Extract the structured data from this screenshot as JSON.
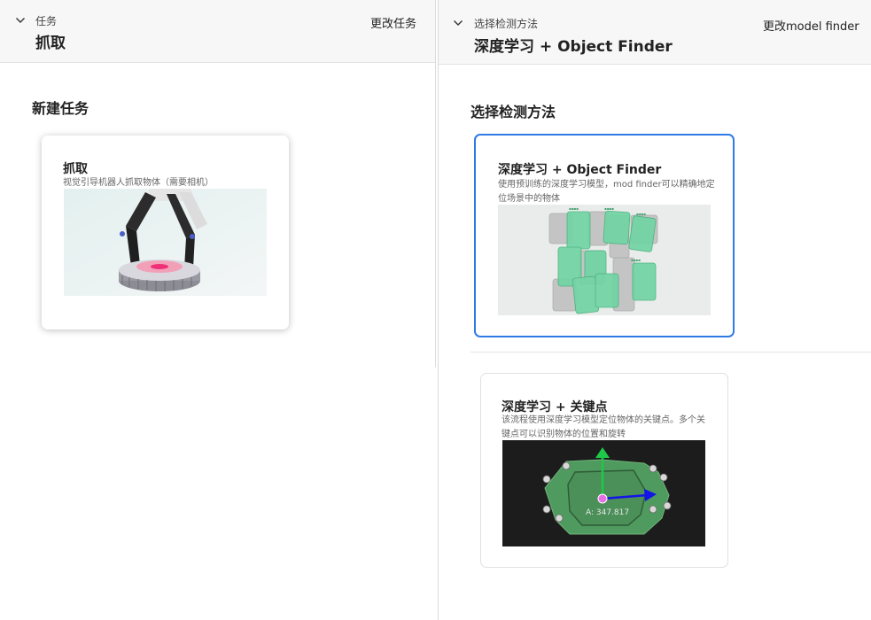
{
  "left": {
    "header": {
      "small_label": "任务",
      "title": "抓取",
      "action": "更改任务"
    },
    "section_title": "新建任务",
    "card": {
      "title": "抓取",
      "description": "视觉引导机器人抓取物体（需要相机）",
      "image_icon": "robot-gripper-picking-gear"
    }
  },
  "right": {
    "header": {
      "small_label": "选择检测方法",
      "title": "深度学习 + Object Finder",
      "action": "更改model finder"
    },
    "section_title": "选择检测方法",
    "cards": [
      {
        "title": "深度学习 + Object Finder",
        "description": "使用预训练的深度学习模型，mod finder可以精确地定位场景中的物体",
        "selected": true,
        "image_icon": "detected-boxes-scene"
      },
      {
        "title": "深度学习 + 关键点",
        "description": "该流程使用深度学习模型定位物体的关键点。多个关键点可以识别物体的位置和旋转",
        "selected": false,
        "image_icon": "keypoint-part-axes",
        "image_label": "A: 347.817"
      }
    ]
  },
  "colors": {
    "accent": "#2f7be5",
    "header_bg": "#f7f7f7",
    "box_green": "#6fd4a3",
    "box_grey": "#c4c4c4",
    "part_green": "#4f9a5e",
    "axis_green": "#1ec94a",
    "axis_blue": "#1414e6",
    "origin_pink": "#e76ee6"
  }
}
